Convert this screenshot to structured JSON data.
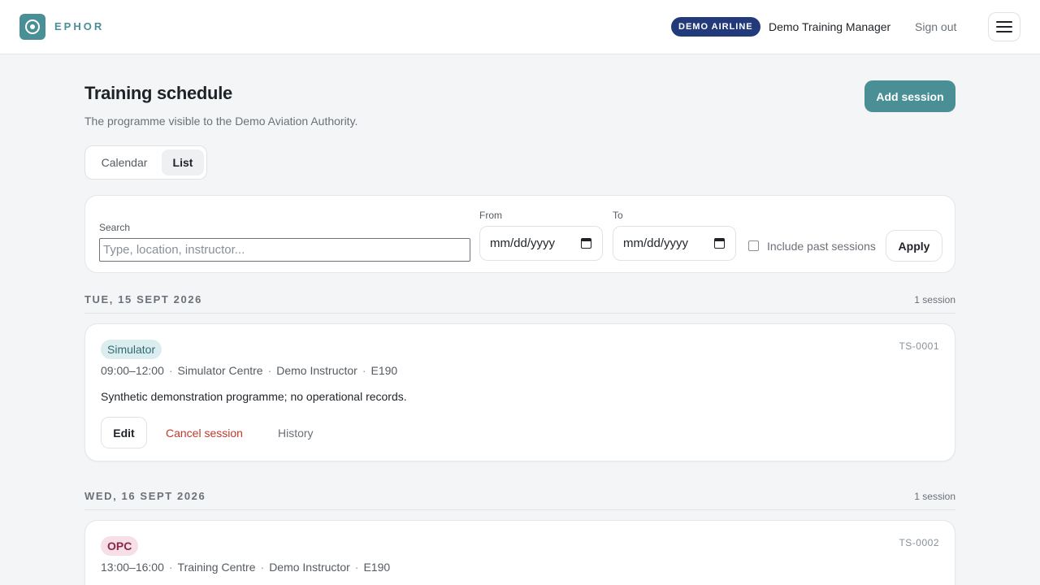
{
  "header": {
    "brand": "EPHOR",
    "airline_badge": "DEMO AIRLINE",
    "user_name": "Demo Training Manager",
    "sign_out": "Sign out",
    "menu_icon": "hamburger-menu-icon"
  },
  "page": {
    "title": "Training schedule",
    "subtitle": "The programme visible to the Demo Aviation Authority.",
    "add_button": "Add session"
  },
  "view_toggle": {
    "options": [
      "Calendar",
      "List"
    ],
    "selected": "List"
  },
  "filters": {
    "search_label": "Search",
    "search_placeholder": "Type, location, instructor...",
    "search_value": "",
    "from_label": "From",
    "from_value": "mm/dd/yyyy",
    "to_label": "To",
    "to_value": "mm/dd/yyyy",
    "include_past_label": "Include past sessions",
    "include_past_checked": false,
    "apply_button": "Apply"
  },
  "days": [
    {
      "date": "TUE, 15 SEPT 2026",
      "count": "1 session",
      "sessions": [
        {
          "type": "Simulator",
          "id": "TS-0001",
          "time": "09:00–12:00",
          "location": "Simulator Centre",
          "instructor": "Demo Instructor",
          "aircraft": "E190",
          "description": "Synthetic demonstration programme; no operational records.",
          "edit": "Edit",
          "cancel": "Cancel session",
          "history": "History"
        }
      ]
    },
    {
      "date": "WED, 16 SEPT 2026",
      "count": "1 session",
      "sessions": [
        {
          "type": "OPC",
          "id": "TS-0002",
          "time": "13:00–16:00",
          "location": "Training Centre",
          "instructor": "Demo Instructor",
          "aircraft": "E190"
        }
      ]
    }
  ],
  "colors": {
    "accent": "#4a8f95",
    "airline_badge": "#233a7a",
    "danger": "#c0392b",
    "simulator_tag_bg": "#dcedef",
    "opc_tag_bg": "#f6dfe7"
  }
}
